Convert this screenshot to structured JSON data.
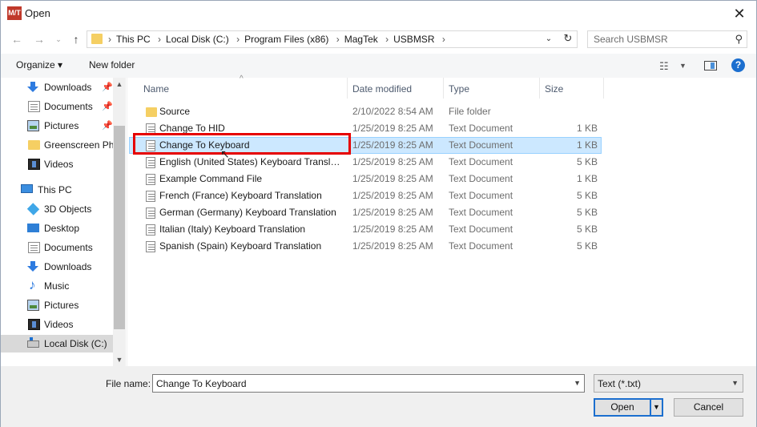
{
  "window": {
    "title": "Open",
    "app_icon_text": "M/T"
  },
  "address": {
    "crumbs": [
      "This PC",
      "Local Disk (C:)",
      "Program Files (x86)",
      "MagTek",
      "USBMSR"
    ],
    "search_placeholder": "Search USBMSR"
  },
  "toolbar": {
    "organize": "Organize ▾",
    "new_folder": "New folder",
    "help": "?"
  },
  "nav": {
    "quick_access": [
      {
        "label": "Downloads",
        "icon": "download-icon",
        "pinned": true
      },
      {
        "label": "Documents",
        "icon": "document-icon",
        "pinned": true
      },
      {
        "label": "Pictures",
        "icon": "pictures-icon",
        "pinned": true
      },
      {
        "label": "Greenscreen Pho",
        "icon": "folder-icon",
        "pinned": false
      },
      {
        "label": "Videos",
        "icon": "video-icon",
        "pinned": false
      }
    ],
    "this_pc": "This PC",
    "pc_items": [
      {
        "label": "3D Objects",
        "icon": "3d-objects-icon"
      },
      {
        "label": "Desktop",
        "icon": "desktop-icon"
      },
      {
        "label": "Documents",
        "icon": "document-icon"
      },
      {
        "label": "Downloads",
        "icon": "download-icon"
      },
      {
        "label": "Music",
        "icon": "music-icon"
      },
      {
        "label": "Pictures",
        "icon": "pictures-icon"
      },
      {
        "label": "Videos",
        "icon": "video-icon"
      },
      {
        "label": "Local Disk (C:)",
        "icon": "disk-icon",
        "selected": true
      }
    ]
  },
  "columns": {
    "name": "Name",
    "date": "Date modified",
    "type": "Type",
    "size": "Size"
  },
  "files": [
    {
      "name": "Source",
      "date": "2/10/2022 8:54 AM",
      "type": "File folder",
      "size": "",
      "kind": "folder"
    },
    {
      "name": "Change To HID",
      "date": "1/25/2019 8:25 AM",
      "type": "Text Document",
      "size": "1 KB",
      "kind": "text"
    },
    {
      "name": "Change To Keyboard",
      "date": "1/25/2019 8:25 AM",
      "type": "Text Document",
      "size": "1 KB",
      "kind": "text",
      "selected": true
    },
    {
      "name": "English (United States) Keyboard Translat...",
      "date": "1/25/2019 8:25 AM",
      "type": "Text Document",
      "size": "5 KB",
      "kind": "text"
    },
    {
      "name": "Example Command File",
      "date": "1/25/2019 8:25 AM",
      "type": "Text Document",
      "size": "1 KB",
      "kind": "text"
    },
    {
      "name": "French (France) Keyboard Translation",
      "date": "1/25/2019 8:25 AM",
      "type": "Text Document",
      "size": "5 KB",
      "kind": "text"
    },
    {
      "name": "German (Germany) Keyboard Translation",
      "date": "1/25/2019 8:25 AM",
      "type": "Text Document",
      "size": "5 KB",
      "kind": "text"
    },
    {
      "name": "Italian (Italy) Keyboard Translation",
      "date": "1/25/2019 8:25 AM",
      "type": "Text Document",
      "size": "5 KB",
      "kind": "text"
    },
    {
      "name": "Spanish (Spain) Keyboard Translation",
      "date": "1/25/2019 8:25 AM",
      "type": "Text Document",
      "size": "5 KB",
      "kind": "text"
    }
  ],
  "footer": {
    "file_name_label": "File name:",
    "file_name_value": "Change To Keyboard",
    "file_type": "Text (*.txt)",
    "open": "Open",
    "cancel": "Cancel"
  },
  "colors": {
    "accent": "#1c6fcf",
    "highlight": "#e60000",
    "selection": "#cce8ff"
  }
}
